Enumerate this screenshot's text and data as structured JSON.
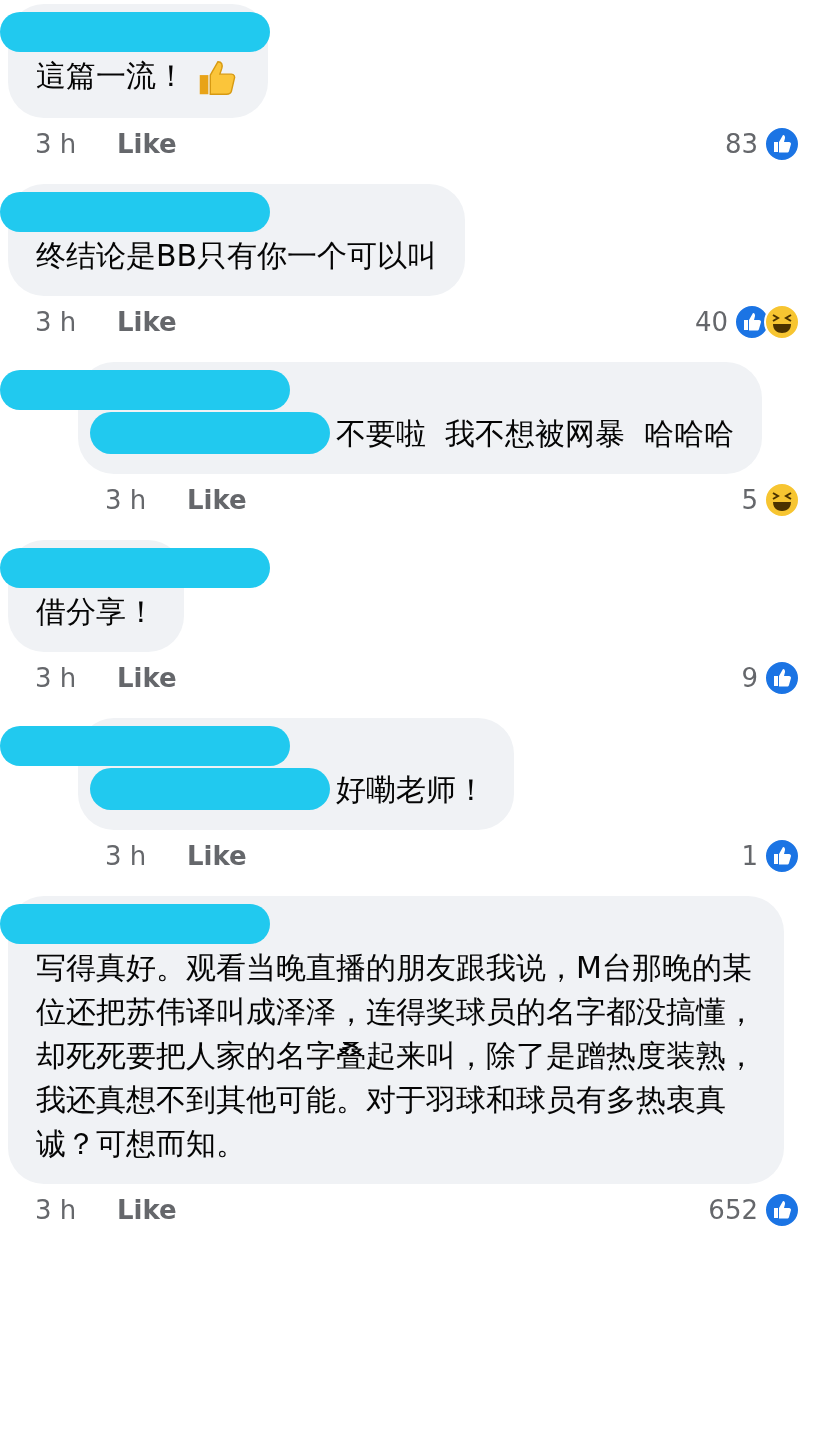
{
  "comments": [
    {
      "kind": "top",
      "text": "這篇一流！",
      "emoji": {
        "kind": "thumbs-up"
      },
      "redacted_mention": false,
      "time": "3 h",
      "like": "Like",
      "count": "83",
      "reactions": [
        {
          "kind": "like"
        }
      ]
    },
    {
      "kind": "top",
      "text": "终结论是BB只有你一个可以叫",
      "redacted_mention": false,
      "time": "3 h",
      "like": "Like",
      "count": "40",
      "reactions": [
        {
          "kind": "like"
        },
        {
          "kind": "haha"
        }
      ]
    },
    {
      "kind": "reply",
      "text": "不要啦  我不想被网暴  哈哈哈",
      "redacted_mention": true,
      "time": "3 h",
      "like": "Like",
      "count": "5",
      "reactions": [
        {
          "kind": "haha"
        }
      ]
    },
    {
      "kind": "top",
      "text": "借分享！",
      "redacted_mention": false,
      "time": "3 h",
      "like": "Like",
      "count": "9",
      "reactions": [
        {
          "kind": "like"
        }
      ]
    },
    {
      "kind": "reply",
      "text": "好嘞老师！",
      "redacted_mention": true,
      "time": "3 h",
      "like": "Like",
      "count": "1",
      "reactions": [
        {
          "kind": "like"
        }
      ]
    },
    {
      "kind": "top",
      "text": "写得真好。观看当晚直播的朋友跟我说，M台那晚的某位还把苏伟译叫成泽泽，连得奖球员的名字都没搞懂，却死死要把人家的名字叠起来叫，除了是蹭热度装熟，我还真想不到其他可能。对于羽球和球员有多热衷真诚？可想而知。",
      "redacted_mention": false,
      "time": "3 h",
      "like": "Like",
      "count": "652",
      "reactions": [
        {
          "kind": "like"
        }
      ]
    }
  ]
}
